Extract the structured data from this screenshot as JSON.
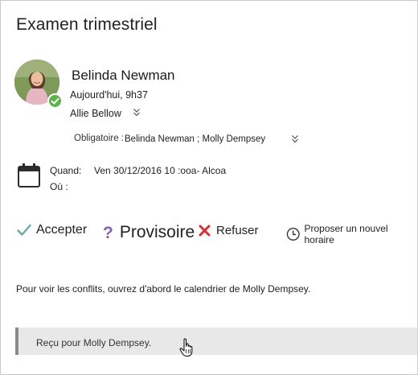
{
  "meeting": {
    "title": "Examen trimestriel"
  },
  "sender": {
    "name": "Belinda Newman",
    "sent_time": "Aujourd'hui, 9h37",
    "to": "Allie Bellow",
    "presence": "available"
  },
  "attendees": {
    "required_label": "Obligatoire :",
    "required_value": "Belinda Newman ; Molly Dempsey"
  },
  "details": {
    "when_label": "Quand:",
    "when_value": "Ven 30/12/2016 10 :ooa- Alcoa",
    "where_label": "Où :"
  },
  "actions": {
    "accept": "Accepter",
    "tentative": "Provisoire",
    "decline": "Refuser",
    "propose": "Proposer un nouvel horaire"
  },
  "conflicts_message": "Pour voir les conflits, ouvrez d'abord le calendrier de Molly Dempsey.",
  "received_banner": "Reçu pour Molly Dempsey.",
  "colors": {
    "accept": "#6aa9a0",
    "tentative": "#8a5cb5",
    "decline": "#d13438",
    "presence": "#5bb34a",
    "banner_bg": "#e8e8e8",
    "banner_bar": "#8a8a8a"
  }
}
